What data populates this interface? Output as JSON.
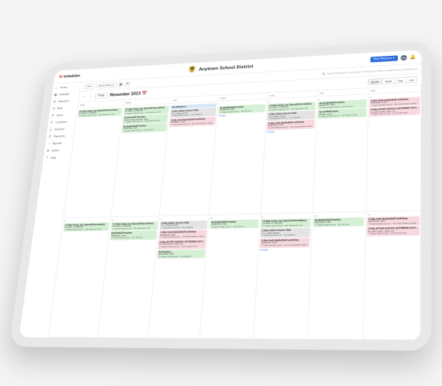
{
  "brand": {
    "prefix": "M",
    "name": "Schedules"
  },
  "district": "Anytown School District",
  "new_request": "New Request",
  "avatar": "MA",
  "sidebar": [
    {
      "icon": "⌂",
      "label": "Home"
    },
    {
      "icon": "▦",
      "label": "Calendar"
    },
    {
      "icon": "☰",
      "label": "Requests"
    },
    {
      "icon": "◷",
      "label": "Now"
    },
    {
      "icon": "⚲",
      "label": "Users"
    },
    {
      "icon": "⚲",
      "label": "Locations"
    },
    {
      "icon": "🧾",
      "label": "Invoices"
    },
    {
      "icon": "$",
      "label": "Payments"
    },
    {
      "icon": "◔",
      "label": "Reports"
    },
    {
      "icon": "⚙",
      "label": "Admin"
    },
    {
      "icon": "?",
      "label": "Help"
    }
  ],
  "toolbar": {
    "filter_btn": "Filter",
    "saved_filters": "Saved Filters ▾",
    "search_placeholder": "Search Requests, Event Name, Requester Name, Group Name, Schedule ID"
  },
  "nav": {
    "today": "Today",
    "month": "November 2023"
  },
  "views": [
    "Month",
    "Week",
    "Day",
    "List"
  ],
  "active_view": "Month",
  "dow": [
    "SUN",
    "MON",
    "TUE",
    "WED",
    "THU",
    "FRI",
    "SAT"
  ],
  "weeks": [
    {
      "dates": [
        "",
        "",
        "",
        "1",
        "2",
        "3",
        "4"
      ],
      "cells": [
        [
          {
            "c": "green",
            "t": "12:30p Camp Joy (Special Recreation)",
            "s": "KG Boys JV Baseball",
            "l": "📍Adams High School – HS Classroom 100"
          }
        ],
        [
          {
            "c": "green",
            "t": "12:30p Camp Joy (Special Recreation)",
            "s": "KG Boys JV Baseball",
            "l": "📍Adams High School – HS Classroom 100"
          },
          {
            "c": "green",
            "t": "4p Baseball Practice",
            "s": "Varsity Boys Baseball Team",
            "l": "📍Adams High School – HS Baseball Fields"
          },
          {
            "c": "green",
            "t": "4p Basketball Practice",
            "s": "Basketball Team",
            "l": "📍Adams High School – ML HS Gym"
          }
        ],
        [
          {
            "c": "blue",
            "t": "9p Halloween",
            "s": "",
            "l": ""
          },
          {
            "c": "gray",
            "t": "2:30p Indoor Soccer Club",
            "s": "XYZ Travel Soccer",
            "l": "📍Elementary School – FS Cafeteria"
          },
          {
            "c": "pink",
            "t": "2:30p Owls Basketball workshop",
            "s": "Basketball Team",
            "l": "📍Intermediate School – ML Intermediate Cafeteria"
          }
        ],
        [
          {
            "c": "green",
            "t": "4p Basketball Practice",
            "s": "Basketball Team",
            "l": "📍Adams High School – ML HS Gym"
          }
        ],
        [
          {
            "c": "green",
            "t": "12:30p Camp Joy (Special Recreation)",
            "s": "KG Boys JV Baseball",
            "l": "📍Adams High School – HS Classroom 100"
          },
          {
            "c": "gray",
            "t": "2:30p Indoor Soccer Club",
            "s": "XYZ Travel Soccer",
            "l": "📍Elementary School – FS Cafeteria"
          },
          {
            "c": "pink",
            "t": "2:30p Owls Basketball workshop",
            "s": "Basketball Team",
            "l": "📍Intermediate School – ML Intermediate Cafeteria"
          }
        ],
        [
          {
            "c": "green",
            "t": "4p Basketball Practice",
            "s": "Basketball Team",
            "l": "📍Adams High School – ML HS Gym"
          },
          {
            "c": "green",
            "t": "4p Softball Game",
            "s": "Athletic Event",
            "l": "📍Adams High School – HS Athletic Field"
          }
        ],
        [
          {
            "c": "pink",
            "t": "2:30p Owls Basketball workshop",
            "s": "Basketball Team",
            "l": "📍Intermediate School – ML Intermediate Cafeteria"
          },
          {
            "c": "pink",
            "t": "3:30p AFTER SCHOOL EXTENDED ACTIVITIES",
            "s": "KG Girls Scout Troop 700",
            "l": "📍Baker High School – Ax football field"
          }
        ]
      ],
      "more": [
        "",
        "",
        "",
        "+2 more",
        "+2 more",
        "",
        ""
      ]
    },
    {
      "dates": [
        "5",
        "6",
        "7",
        "8",
        "9",
        "10",
        "11"
      ],
      "cells": [
        [
          {
            "c": "green",
            "t": "12:30p Camp Joy (Special Recreation)",
            "s": "KG Boys JV Baseball",
            "l": "📍Adams High School – HS Classroom 100"
          }
        ],
        [
          {
            "c": "green",
            "t": "12:30p Camp Joy (Special Recreation)",
            "s": "KG Boys JV Baseball",
            "l": "📍Adams High School – HS Classroom 100"
          },
          {
            "c": "green",
            "t": "Basketball Practice",
            "s": "Basketball Team",
            "l": "📍Adams High School – ML HS Gym"
          }
        ],
        [
          {
            "c": "gray",
            "t": "2:30p Indoor Soccer Club",
            "s": "XYZ Travel Soccer",
            "l": "📍Elementary School – FS Cafeteria"
          },
          {
            "c": "pink",
            "t": "2:30p Owls Basketball workshop",
            "s": "Basketball Team",
            "l": "📍Intermediate School – ML Intermediate Cafeteria"
          },
          {
            "c": "pink",
            "t": "3:30p AFTER SCHOOL EXTENDED ACTIVITIES",
            "s": "KG Girls Scout Troop 700",
            "l": "📍Adams High School – HS Football Track"
          },
          {
            "c": "green",
            "t": "5p Practice",
            "s": "Basketball Team",
            "l": "📍Adams High School – HS Baseball"
          }
        ],
        [
          {
            "c": "green",
            "t": "4p Basketball Practice",
            "s": "Basketball Team",
            "l": "📍Adams High School – ML HS Gym"
          }
        ],
        [
          {
            "c": "green",
            "t": "12:30p Camp Joy (Special Recreation)",
            "s": "KG Boys JV Baseball",
            "l": "📍Adams High School – HS Classroom 100"
          },
          {
            "c": "gray",
            "t": "2:30p Indoor Soccer Club",
            "s": "XYZ Travel Soccer",
            "l": "📍Elementary School – FS Cafeteria"
          },
          {
            "c": "pink",
            "t": "2:30p Owls Basketball workshop",
            "s": "Basketball Team",
            "l": "📍Intermediate School – ML Intermediate Cafeteria"
          }
        ],
        [
          {
            "c": "green",
            "t": "4p Basketball Practice",
            "s": "Basketball Team",
            "l": "📍Adams High School – ML HS Gym"
          }
        ],
        [
          {
            "c": "pink",
            "t": "2:30p Owls Basketball workshop",
            "s": "Basketball Team",
            "l": "📍Intermediate School – ML Intermediate Cafeteria"
          },
          {
            "c": "pink",
            "t": "3:30p AFTER SCHOOL EXTENDED ACTIVITIES",
            "s": "KG Girls Scout Troop 700",
            "l": "📍Baker High School – Bx football field"
          }
        ]
      ],
      "more": [
        "",
        "",
        "",
        "",
        "+2 more",
        "",
        ""
      ]
    }
  ]
}
